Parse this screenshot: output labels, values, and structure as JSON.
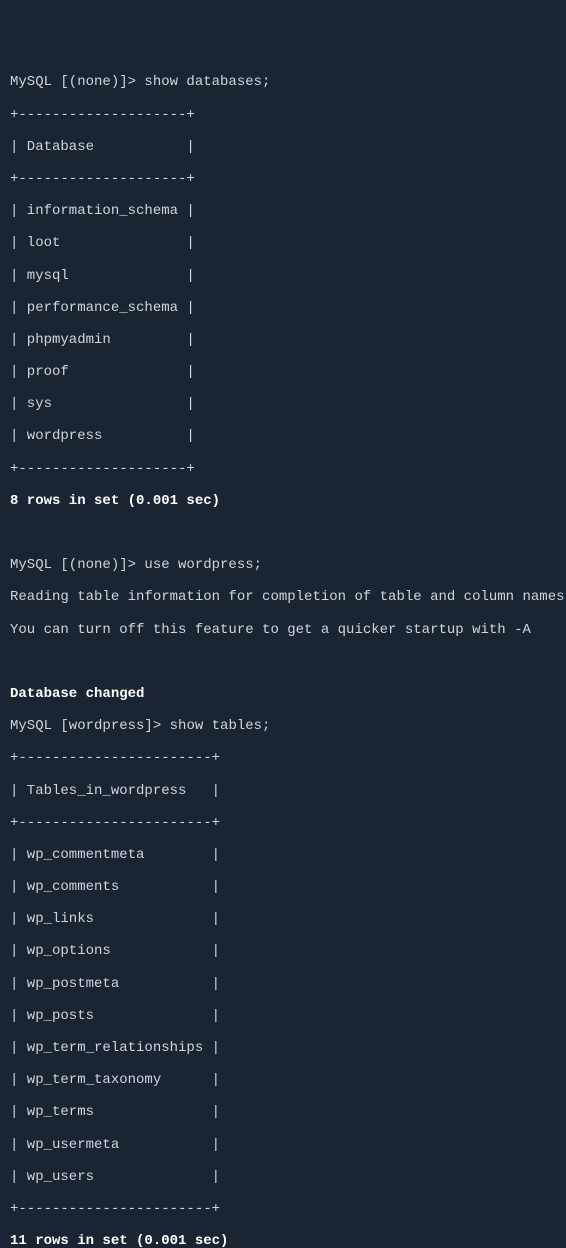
{
  "prompt1": {
    "prefix": "MySQL [(none)]> ",
    "command": "show databases;"
  },
  "databases_table": {
    "border_top": "+--------------------+",
    "header": "| Database           |",
    "border_mid": "+--------------------+",
    "rows": [
      "| information_schema |",
      "| loot               |",
      "| mysql              |",
      "| performance_schema |",
      "| phpmyadmin         |",
      "| proof              |",
      "| sys                |",
      "| wordpress          |"
    ],
    "border_bottom": "+--------------------+",
    "data": [
      "information_schema",
      "loot",
      "mysql",
      "performance_schema",
      "phpmyadmin",
      "proof",
      "sys",
      "wordpress"
    ]
  },
  "result1": "8 rows in set (0.001 sec)",
  "blank1": " ",
  "prompt2": {
    "prefix": "MySQL [(none)]> ",
    "command": "use wordpress;"
  },
  "reading1": "Reading table information for completion of table and column names",
  "reading2": "You can turn off this feature to get a quicker startup with -A",
  "blank2": " ",
  "db_changed": "Database changed",
  "prompt3": {
    "prefix": "MySQL [wordpress]> ",
    "command": "show tables;"
  },
  "tables_table": {
    "border_top": "+-----------------------+",
    "header": "| Tables_in_wordpress   |",
    "border_mid": "+-----------------------+",
    "rows": [
      "| wp_commentmeta        |",
      "| wp_comments           |",
      "| wp_links              |",
      "| wp_options            |",
      "| wp_postmeta           |",
      "| wp_posts              |",
      "| wp_term_relationships |",
      "| wp_term_taxonomy      |",
      "| wp_terms              |",
      "| wp_usermeta           |",
      "| wp_users              |"
    ],
    "border_bottom": "+-----------------------+",
    "data": [
      "wp_commentmeta",
      "wp_comments",
      "wp_links",
      "wp_options",
      "wp_postmeta",
      "wp_posts",
      "wp_term_relationships",
      "wp_term_taxonomy",
      "wp_terms",
      "wp_usermeta",
      "wp_users"
    ]
  },
  "result2": "11 rows in set (0.001 sec)"
}
